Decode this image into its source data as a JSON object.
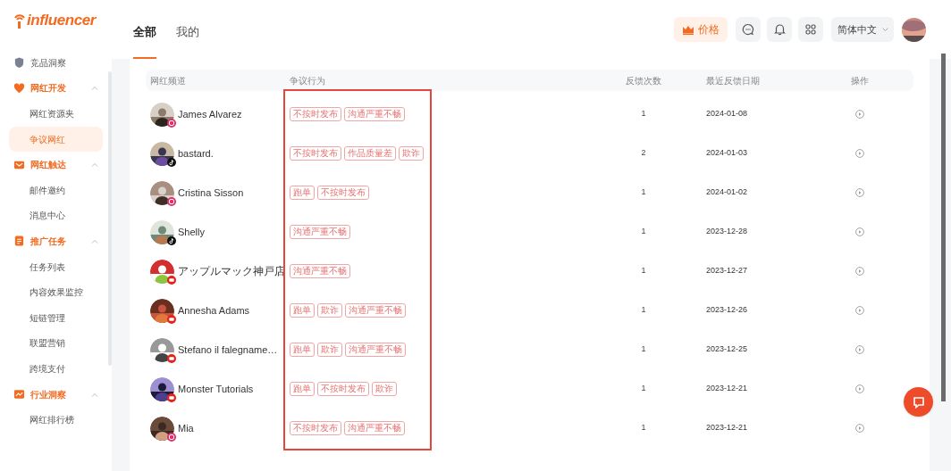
{
  "logo": "influencer",
  "sidebar": {
    "items": [
      {
        "label": "竞品洞察",
        "selected": false
      },
      {
        "label": "网红开发",
        "expanded": true,
        "selected": false,
        "children": [
          {
            "label": "网红资源夹",
            "selected": false
          },
          {
            "label": "争议网红",
            "selected": true
          }
        ]
      },
      {
        "label": "网红触达",
        "expanded": true,
        "selected": false,
        "children": [
          {
            "label": "邮件邀约",
            "selected": false
          },
          {
            "label": "消息中心",
            "selected": false
          }
        ]
      },
      {
        "label": "推广任务",
        "expanded": true,
        "selected": false,
        "children": [
          {
            "label": "任务列表",
            "selected": false
          },
          {
            "label": "内容效果监控",
            "selected": false
          },
          {
            "label": "短链管理",
            "selected": false
          },
          {
            "label": "联盟营销",
            "selected": false
          },
          {
            "label": "跨境支付",
            "selected": false
          }
        ]
      },
      {
        "label": "行业洞察",
        "expanded": true,
        "selected": false,
        "children": [
          {
            "label": "网红排行榜",
            "selected": false
          }
        ]
      }
    ]
  },
  "tabs": [
    {
      "label": "全部",
      "selected": true
    },
    {
      "label": "我的",
      "selected": false
    }
  ],
  "header": {
    "pricing_button": "价格",
    "language": "简体中文"
  },
  "table": {
    "columns": [
      "网红频道",
      "争议行为",
      "反馈次数",
      "最近反馈日期",
      "操作"
    ],
    "rows": [
      {
        "name": "James Alvarez",
        "kind": "instagram",
        "tags": [
          "不按时发布",
          "沟通严重不畅"
        ],
        "count": "1",
        "date": "2024-01-08"
      },
      {
        "name": "bastard.",
        "kind": "tiktok",
        "tags": [
          "不按时发布",
          "作品质量差",
          "欺诈"
        ],
        "count": "2",
        "date": "2024-01-03"
      },
      {
        "name": "Cristina Sisson",
        "kind": "instagram",
        "tags": [
          "跑单",
          "不按时发布"
        ],
        "count": "1",
        "date": "2024-01-02"
      },
      {
        "name": "Shelly",
        "kind": "tiktok",
        "tags": [
          "沟通严重不畅"
        ],
        "count": "1",
        "date": "2023-12-28"
      },
      {
        "name": "アップルマック神戸店",
        "kind": "youtube",
        "tags": [
          "沟通严重不畅"
        ],
        "count": "1",
        "date": "2023-12-27"
      },
      {
        "name": "Annesha Adams",
        "kind": "youtube",
        "tags": [
          "跑单",
          "欺诈",
          "沟通严重不畅"
        ],
        "count": "1",
        "date": "2023-12-26"
      },
      {
        "name": "Stefano il falegname…",
        "kind": "youtube",
        "tags": [
          "跑单",
          "欺诈",
          "沟通严重不畅"
        ],
        "count": "1",
        "date": "2023-12-25"
      },
      {
        "name": "Monster Tutorials",
        "kind": "youtube",
        "tags": [
          "跑单",
          "不按时发布",
          "欺诈"
        ],
        "count": "1",
        "date": "2023-12-21"
      },
      {
        "name": "Mia",
        "kind": "instagram",
        "tags": [
          "不按时发布",
          "沟通严重不畅"
        ],
        "count": "1",
        "date": "2023-12-21"
      }
    ]
  }
}
